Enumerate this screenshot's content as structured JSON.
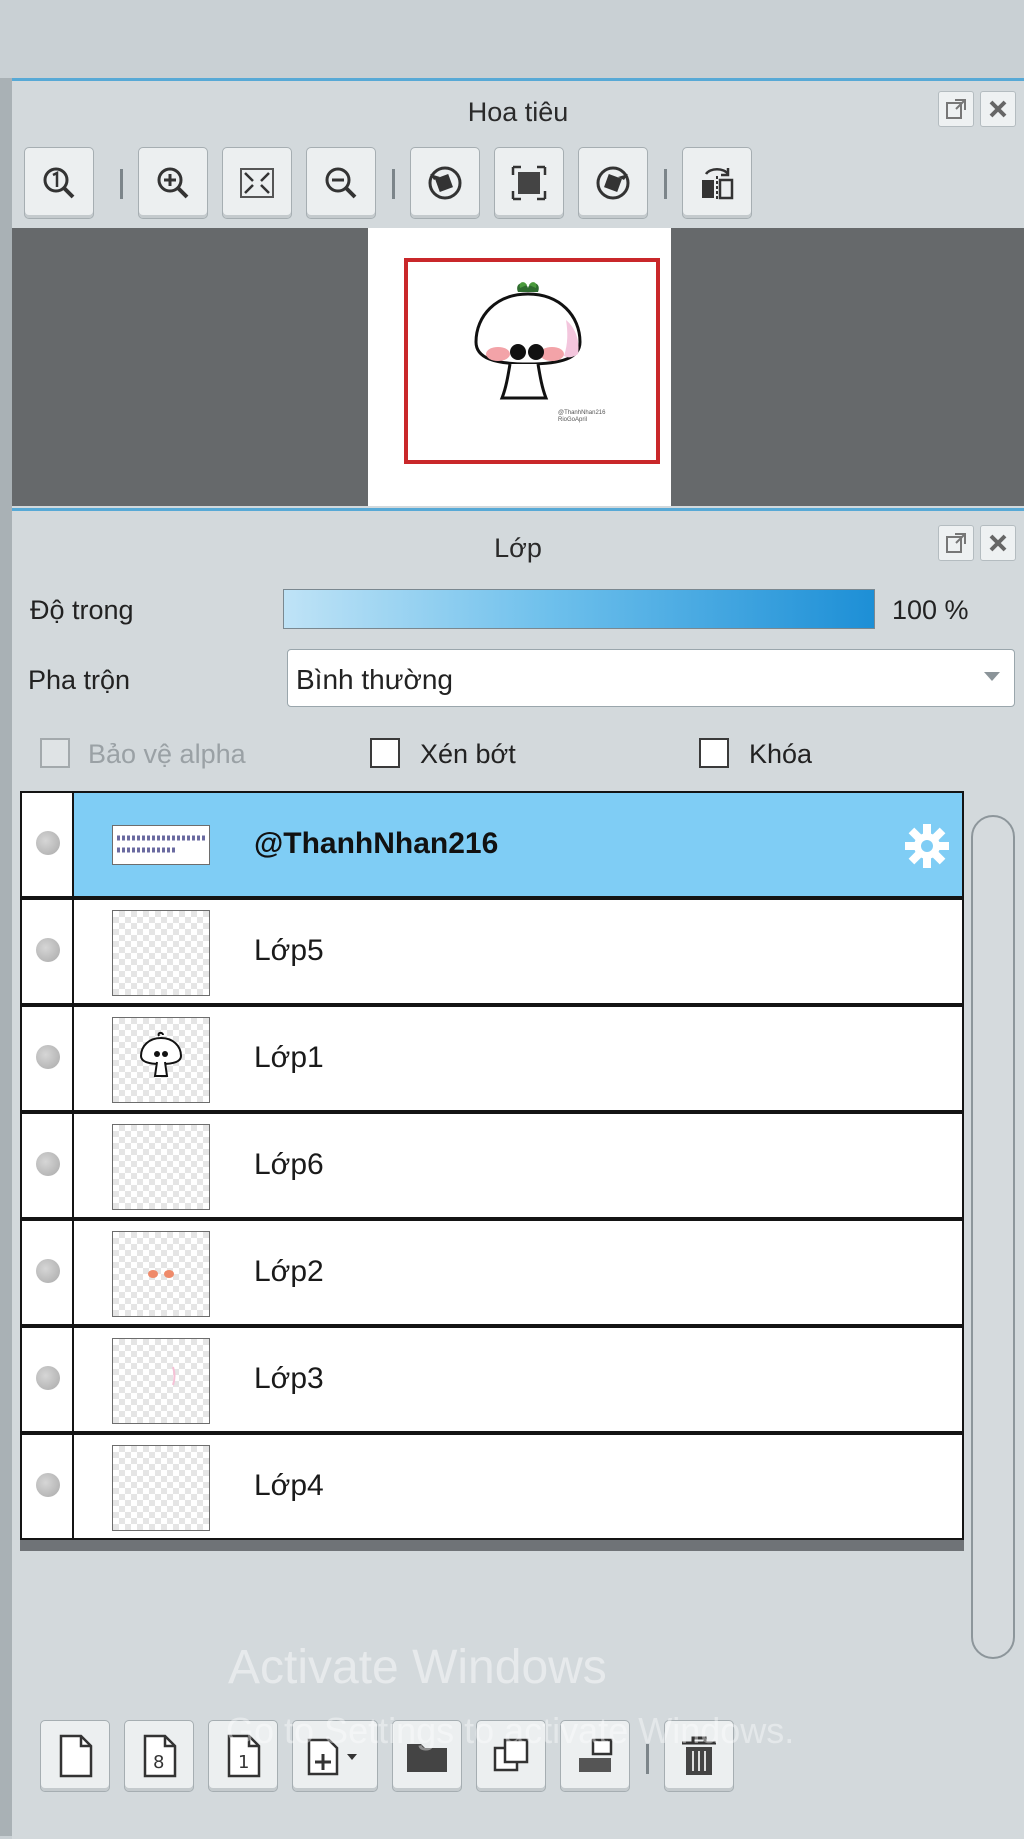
{
  "navigator": {
    "title": "Hoa tiêu",
    "toolbar": [
      "zoom-actual-icon",
      "zoom-in-icon",
      "fit-screen-icon",
      "zoom-out-icon",
      "rotate-left-icon",
      "rotate-reset-icon",
      "rotate-right-icon",
      "flip-horizontal-icon"
    ],
    "thumbnail_caption": "@ThanhNhan216 RioGoApril"
  },
  "layers_panel": {
    "title": "Lớp",
    "opacity_label": "Độ trong",
    "opacity_value": "100 %",
    "opacity_fraction": 1.0,
    "blend_label": "Pha trộn",
    "blend_value": "Bình thường",
    "protect_alpha_label": "Bảo vệ alpha",
    "clipping_label": "Xén bớt",
    "lock_label": "Khóa",
    "layers": [
      {
        "name": "@ThanhNhan216",
        "selected": true
      },
      {
        "name": "Lớp5",
        "selected": false
      },
      {
        "name": "Lớp1",
        "selected": false
      },
      {
        "name": "Lớp6",
        "selected": false
      },
      {
        "name": "Lớp2",
        "selected": false
      },
      {
        "name": "Lớp3",
        "selected": false
      },
      {
        "name": "Lớp4",
        "selected": false
      }
    ],
    "bottom_toolbar": [
      "new-layer-icon",
      "new-8bit-layer-icon",
      "new-1bit-layer-icon",
      "add-layer-dropdown-icon",
      "new-folder-icon",
      "duplicate-layer-icon",
      "merge-down-icon",
      "delete-layer-icon"
    ]
  },
  "watermark": {
    "line1": "Activate Windows",
    "line2": "Go to Settings to activate Windows."
  }
}
